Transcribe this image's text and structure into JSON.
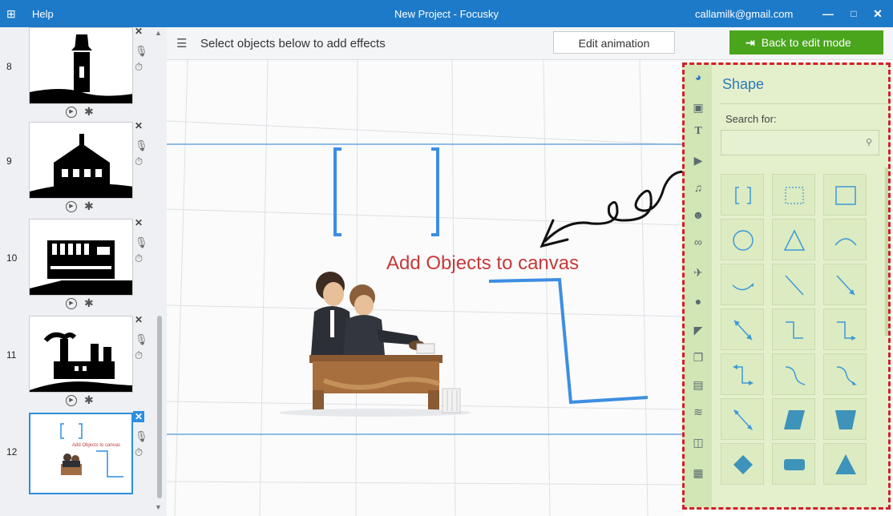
{
  "titlebar": {
    "help": "Help",
    "title": "New Project - Focusky",
    "email": "callamilk@gmail.com",
    "minimize": "—",
    "maximize": "□",
    "close": "✕"
  },
  "slides": [
    {
      "number": "8"
    },
    {
      "number": "9"
    },
    {
      "number": "10"
    },
    {
      "number": "11"
    },
    {
      "number": "12",
      "thumb_text": "Add Objects to canvas"
    }
  ],
  "toolbar": {
    "hint": "Select objects below to add effects",
    "edit_animation": "Edit animation",
    "back_to_edit": "Back to edit mode"
  },
  "canvas": {
    "text": "Add Objects to canvas"
  },
  "panel": {
    "title": "Shape",
    "search_label": "Search for:",
    "search_value": "",
    "categories": [
      "shape",
      "image",
      "text",
      "video",
      "music",
      "people",
      "link",
      "plane",
      "flash",
      "sticker",
      "layers",
      "layout",
      "stack",
      "note",
      "document"
    ],
    "shapes": [
      "brackets",
      "dotted-rect",
      "rectangle",
      "circle",
      "triangle",
      "arc",
      "curved-arrow",
      "line",
      "arrow",
      "double-arrow",
      "elbow-line",
      "elbow-arrow",
      "elbow-double-arrow",
      "curve",
      "curve-arrow",
      "curve-double-arrow",
      "parallelogram",
      "trapezoid",
      "diamond",
      "rounded-rect",
      "filled-triangle"
    ]
  },
  "colors": {
    "titlebar": "#1d7ac8",
    "back_button": "#4aa51c",
    "panel_border": "#d0202a",
    "canvas_text": "#c43a3a",
    "accent_blue": "#2d8ee0"
  }
}
